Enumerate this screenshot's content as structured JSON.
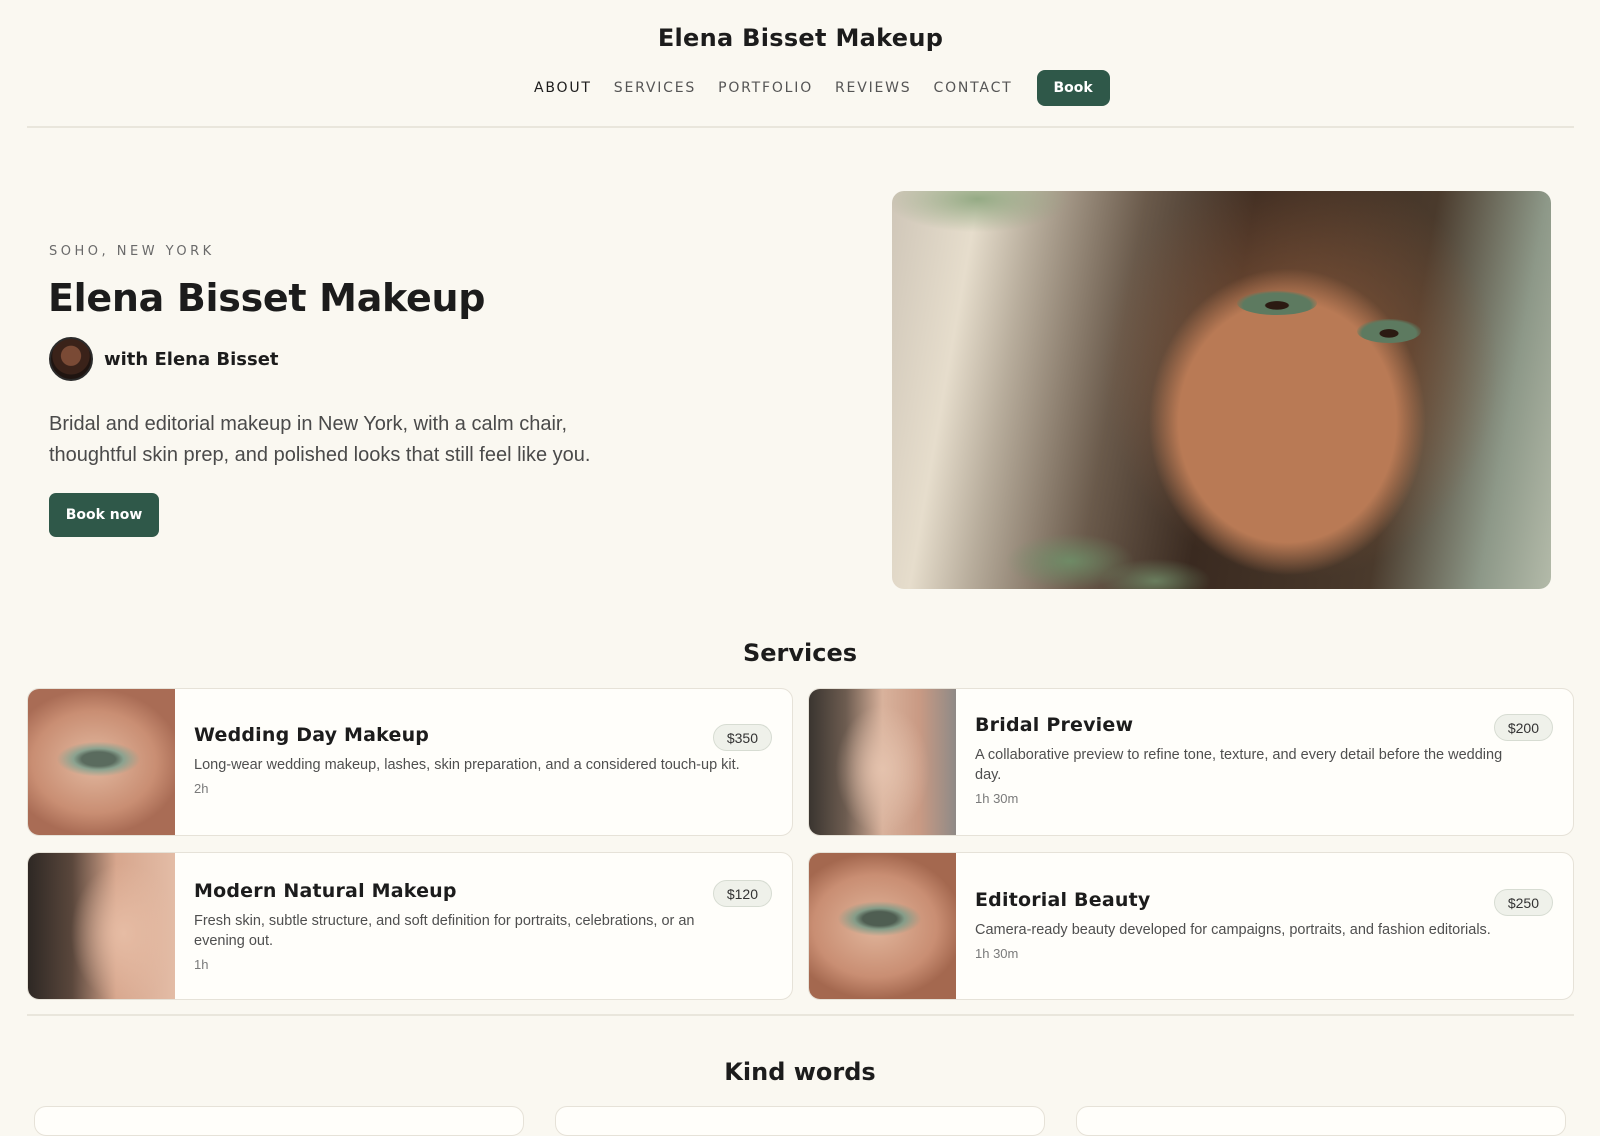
{
  "header": {
    "brand": "Elena Bisset Makeup",
    "nav": [
      "ABOUT",
      "SERVICES",
      "PORTFOLIO",
      "REVIEWS",
      "CONTACT"
    ],
    "book_label": "Book"
  },
  "hero": {
    "eyebrow": "SOHO, NEW YORK",
    "title": "Elena Bisset Makeup",
    "host": "with Elena Bisset",
    "description": "Bridal and editorial makeup in New York, with a calm chair, thoughtful skin prep, and polished looks that still feel like you.",
    "cta": "Book now"
  },
  "services": {
    "title": "Services",
    "items": [
      {
        "name": "Wedding Day Makeup",
        "price": "$350",
        "description": "Long-wear wedding makeup, lashes, skin preparation, and a considered touch-up kit.",
        "duration": "2h"
      },
      {
        "name": "Bridal Preview",
        "price": "$200",
        "description": "A collaborative preview to refine tone, texture, and every detail before the wedding day.",
        "duration": "1h 30m"
      },
      {
        "name": "Modern Natural Makeup",
        "price": "$120",
        "description": "Fresh skin, subtle structure, and soft definition for portraits, celebrations, or an evening out.",
        "duration": "1h"
      },
      {
        "name": "Editorial Beauty",
        "price": "$250",
        "description": "Camera-ready beauty developed for campaigns, portraits, and fashion editorials.",
        "duration": "1h 30m"
      }
    ]
  },
  "reviews": {
    "title": "Kind words"
  },
  "colors": {
    "accent": "#2f5849",
    "background": "#faf8f1",
    "card": "#fffefa"
  }
}
